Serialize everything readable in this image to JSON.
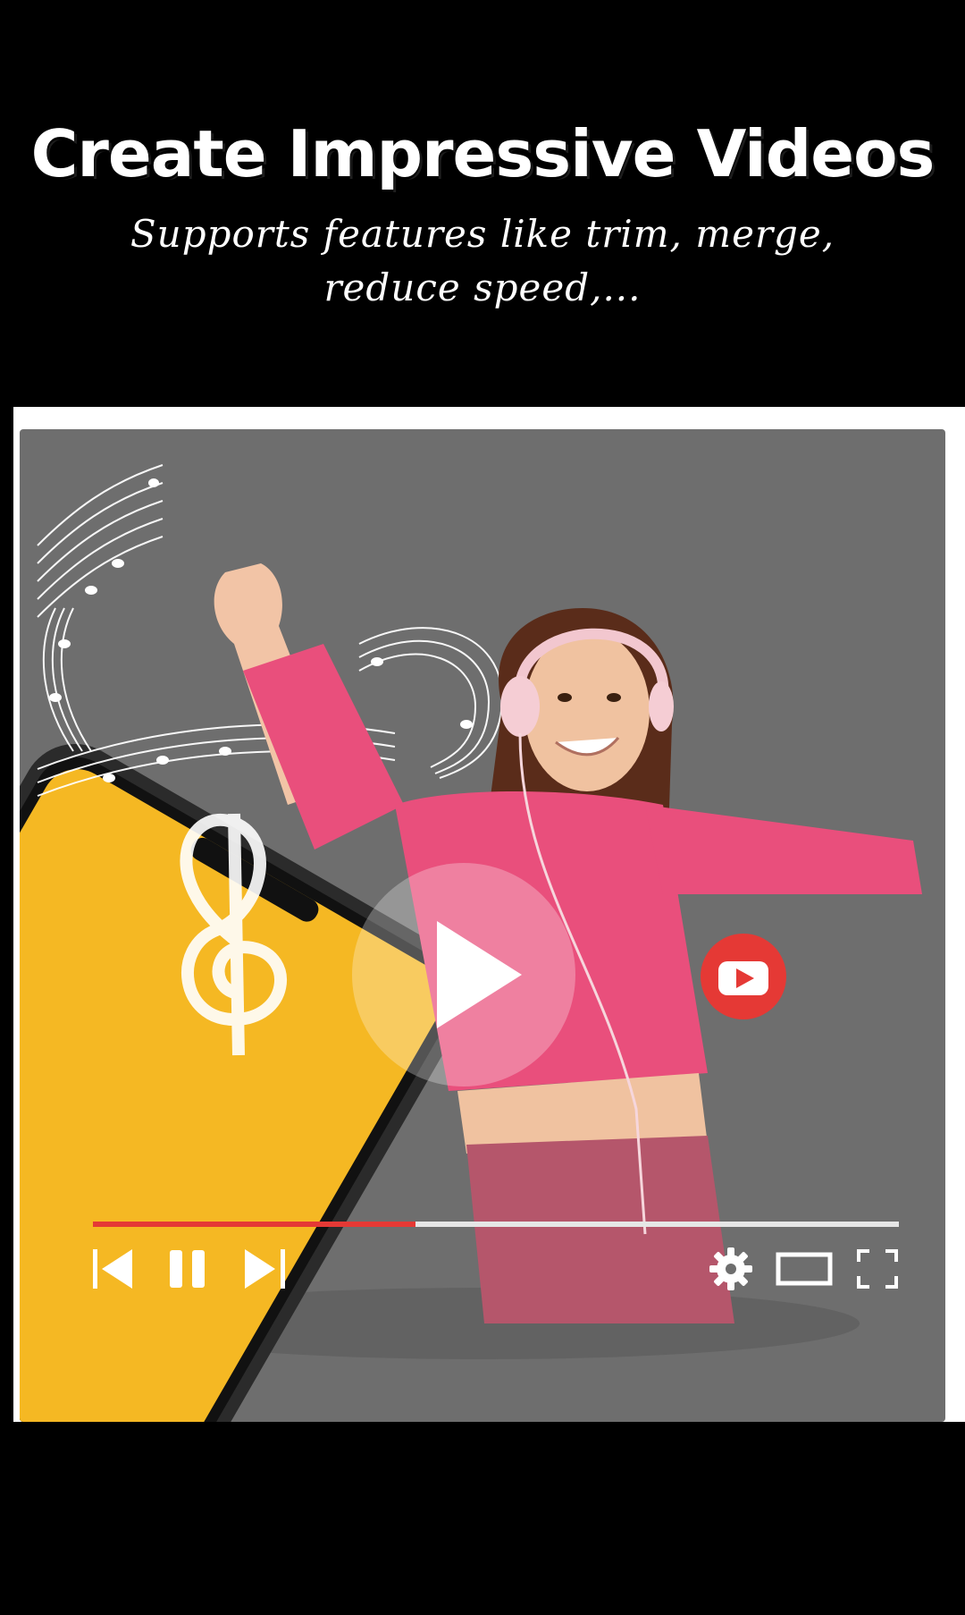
{
  "header": {
    "title": "Create Impressive Videos",
    "subtitle": "Supports features like trim, merge, reduce speed,..."
  },
  "player": {
    "progress": 0.4,
    "accent_color": "#e53935",
    "panel_color": "#6e6e6e",
    "controls": {
      "previous_icon": "skip-previous-icon",
      "pause_icon": "pause-icon",
      "next_icon": "skip-next-icon",
      "settings_icon": "gear-icon",
      "theater_icon": "theater-mode-icon",
      "fullscreen_icon": "fullscreen-icon"
    },
    "center_icon": "play-icon"
  },
  "illustration": {
    "phone_screen_color": "#f5b823",
    "sweater_color": "#e94f7c",
    "logo_icon": "youtube-logo-icon",
    "music_icon": "music-notes-icon"
  }
}
